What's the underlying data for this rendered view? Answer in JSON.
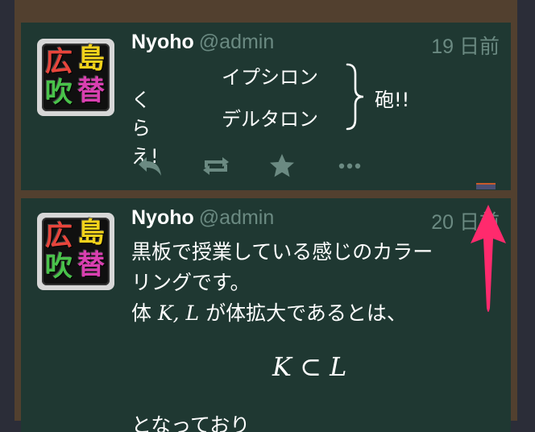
{
  "toots": [
    {
      "author_name": "Nyoho",
      "author_handle": "@admin",
      "time": "19 日前",
      "content": {
        "prefix": "くらえ!",
        "line1": "イプシロン",
        "line2": "デルタロン",
        "suffix": "砲!!"
      },
      "actions": [
        "reply-icon",
        "boost-icon",
        "favourite-icon",
        "more-icon"
      ]
    },
    {
      "author_name": "Nyoho",
      "author_handle": "@admin",
      "time": "20 日前",
      "content": {
        "line1": "黒板で授業している感じのカラー",
        "line2": "リングです。",
        "line3_pre": "体",
        "line3_math": "K, L",
        "line3_post": "が体拡大であるとは、",
        "math_block": "K ⊂ L",
        "partial": "となっており"
      }
    }
  ],
  "avatar": {
    "chars": [
      "広",
      "島",
      "吹",
      "替"
    ],
    "colors": [
      "#e8453c",
      "#f2d21b",
      "#49c24a",
      "#d93fb0"
    ]
  },
  "colors": {
    "background": "#2b2d38",
    "frame": "#52402f",
    "toot_bg": "#1f3832",
    "muted": "#6b8a82",
    "arrow": "#ff2a6d"
  }
}
